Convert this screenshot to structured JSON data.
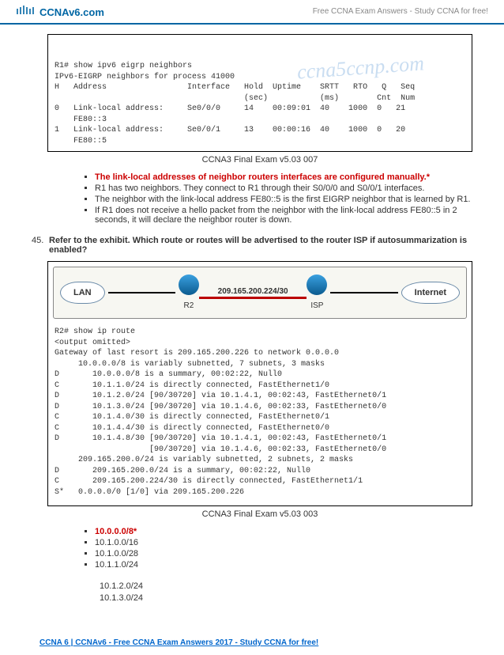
{
  "header": {
    "logo": "CCNAv6.com",
    "tagline": "Free CCNA Exam Answers - Study CCNA for free!"
  },
  "cli1": {
    "line1": "R1# show ipv6 eigrp neighbors",
    "line2": "IPv6-EIGRP neighbors for process 41000",
    "hdr": "H   Address                 Interface   Hold  Uptime    SRTT   RTO   Q   Seq",
    "hdr2": "                                        (sec)           (ms)        Cnt  Num",
    "r0a": "0   Link-local address:     Se0/0/0     14    00:09:01  40    1000  0   21",
    "r0b": "    FE80::3",
    "r1a": "1   Link-local address:     Se0/0/1     13    00:00:16  40    1000  0   20",
    "r1b": "    FE80::5",
    "watermark": "ccna5ccnp.com"
  },
  "caption1": "CCNA3 Final Exam v5.03 007",
  "q44": {
    "a1": "The link-local addresses of neighbor routers interfaces are configured manually.*",
    "a2": "R1 has two neighbors. They connect to R1 through their S0/0/0 and S0/0/1 interfaces.",
    "a3": "The neighbor with the link-local address FE80::5 is the first EIGRP neighbor that is learned by R1.",
    "a4": "If R1 does not receive a hello packet from the neighbor with the link-local address FE80::5 in 2 seconds, it will declare the neighbor router is down."
  },
  "q45": {
    "num": "45.",
    "text": "Refer to the exhibit. Which route or routes will be advertised to the router ISP if autosummarization is enabled?"
  },
  "topo": {
    "lan": "LAN",
    "r2": "R2",
    "subnet": "209.165.200.224/30",
    "isp": "ISP",
    "internet": "Internet"
  },
  "routes": "R2# show ip route\n<output omitted>\nGateway of last resort is 209.165.200.226 to network 0.0.0.0\n     10.0.0.0/8 is variably subnetted, 7 subnets, 3 masks\nD       10.0.0.0/8 is a summary, 00:02:22, Null0\nC       10.1.1.0/24 is directly connected, FastEthernet1/0\nD       10.1.2.0/24 [90/30720] via 10.1.4.1, 00:02:43, FastEthernet0/1\nD       10.1.3.0/24 [90/30720] via 10.1.4.6, 00:02:33, FastEthernet0/0\nC       10.1.4.0/30 is directly connected, FastEthernet0/1\nC       10.1.4.4/30 is directly connected, FastEthernet0/0\nD       10.1.4.8/30 [90/30720] via 10.1.4.1, 00:02:43, FastEthernet0/1\n                    [90/30720] via 10.1.4.6, 00:02:33, FastEthernet0/0\n     209.165.200.0/24 is variably subnetted, 2 subnets, 2 masks\nD       209.165.200.0/24 is a summary, 00:02:22, Null0\nC       209.165.200.224/30 is directly connected, FastEthernet1/1\nS*   0.0.0.0/0 [1/0] via 209.165.200.226",
  "caption2": "CCNA3 Final Exam v5.03 003",
  "a45": {
    "a1": "10.0.0.0/8*",
    "a2": "10.1.0.0/16",
    "a3": "10.1.0.0/28",
    "a4": "10.1.1.0/24",
    "a5": "10.1.2.0/24",
    "a6": "10.1.3.0/24"
  },
  "footer": "CCNA 6 | CCNAv6 - Free CCNA Exam Answers 2017 - Study CCNA for free!"
}
